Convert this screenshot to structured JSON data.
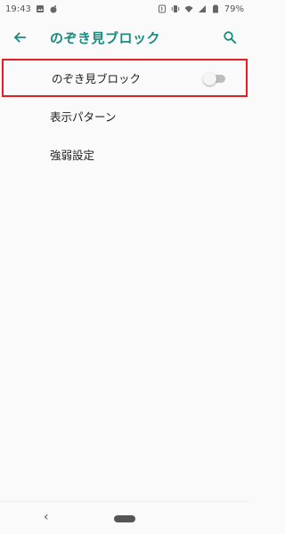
{
  "status_bar": {
    "time": "19:43",
    "battery": "79%"
  },
  "app_bar": {
    "title": "のぞき見ブロック",
    "back_icon": "arrow-back-icon",
    "search_icon": "search-icon"
  },
  "settings": {
    "items": [
      {
        "label": "のぞき見ブロック",
        "toggle": "off"
      },
      {
        "label": "表示パターン"
      },
      {
        "label": "強弱設定"
      }
    ]
  },
  "nav_bar": {
    "back_glyph": "‹"
  },
  "colors": {
    "accent": "#1a8a7e",
    "highlight_border": "#e02020"
  }
}
